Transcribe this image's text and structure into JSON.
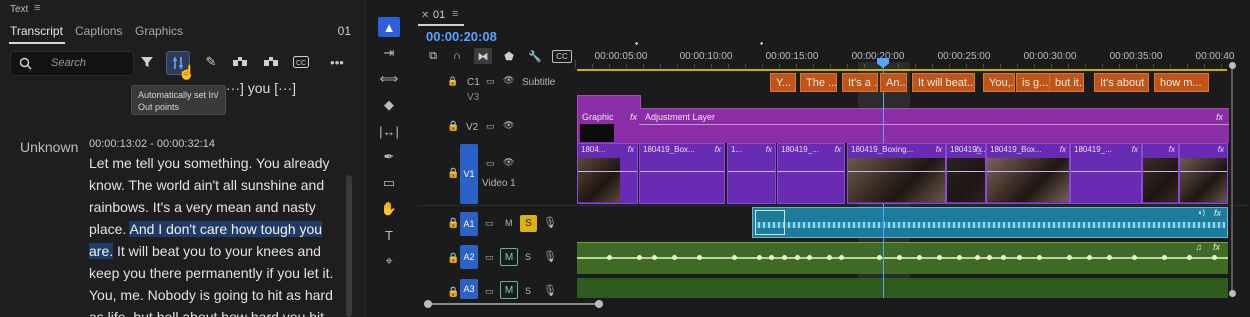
{
  "text_panel": {
    "title": "Text",
    "menu_icon": "hamburger-icon",
    "tabs": [
      {
        "label": "Transcript",
        "active": true
      },
      {
        "label": "Captions",
        "active": false
      },
      {
        "label": "Graphics",
        "active": false
      }
    ],
    "count": "01",
    "search": {
      "placeholder": "Search"
    },
    "toolbar": [
      "filter-icon",
      "set-in-out-icon",
      "pencil-icon",
      "speaker-icon",
      "merge-icon",
      "captions-icon",
      "more-icon"
    ],
    "tooltip": "Automatically set In/ Out points",
    "previous_line": "···] you [···]",
    "speaker": "Unknown",
    "timecode": "00:00:13:02 - 00:00:32:14",
    "transcript_before": "Let me tell you something. You already know. The world ain't all sunshine and rainbows. It's a very mean and nasty place. ",
    "transcript_highlight": "And I don't care how tough you are.",
    "transcript_after": " It will beat you to your knees and keep you there permanently if you let it. You, me. Nobody is going to hit as hard as life, but hell about how hard you hit..."
  },
  "timeline": {
    "sequence_name": "01",
    "playhead_timecode": "00:00:20:08",
    "ruler_labels": [
      "00:00:05:00",
      "00:00:10:00",
      "00:00:15:00",
      "00:00:20:00",
      "00:00:25:00",
      "00:00:30:00",
      "00:00:35:00",
      "00:00:40"
    ],
    "tracks": {
      "c1": {
        "name": "C1",
        "label": "Subtitle"
      },
      "v3": {
        "name": "V3"
      },
      "v2": {
        "name": "V2"
      },
      "v1": {
        "name": "V1",
        "label": "Video 1"
      },
      "a1": {
        "name": "A1",
        "mute": "M",
        "solo": "S"
      },
      "a2": {
        "name": "A2",
        "mute": "M",
        "solo": "S"
      },
      "a3": {
        "name": "A3",
        "mute": "M",
        "solo": "S"
      }
    },
    "caption_clips": [
      "Y...",
      "The ...",
      "It's a ...",
      "An...",
      "It will beat...",
      "You,...",
      "is g...",
      "but it...",
      "It's about ...",
      "how m..."
    ],
    "v2_clips": {
      "graphic": "Graphic",
      "adjustment": "Adjustment Layer",
      "fx": "fx"
    },
    "v1_clips": [
      "1804...",
      "180419_Box...",
      "1...",
      "180419_...",
      "180419_Boxing...",
      "180419_...",
      "180419_Box...",
      "180419_...",
      "",
      ""
    ],
    "colors": {
      "accent": "#2b62c8",
      "caption": "#c0551a",
      "video": "#6a2bb4",
      "adjustment": "#8b2ea5",
      "audio_a1": "#1d7b9c",
      "audio_a2": "#3f6b27",
      "playhead": "#5aa2ff"
    }
  }
}
